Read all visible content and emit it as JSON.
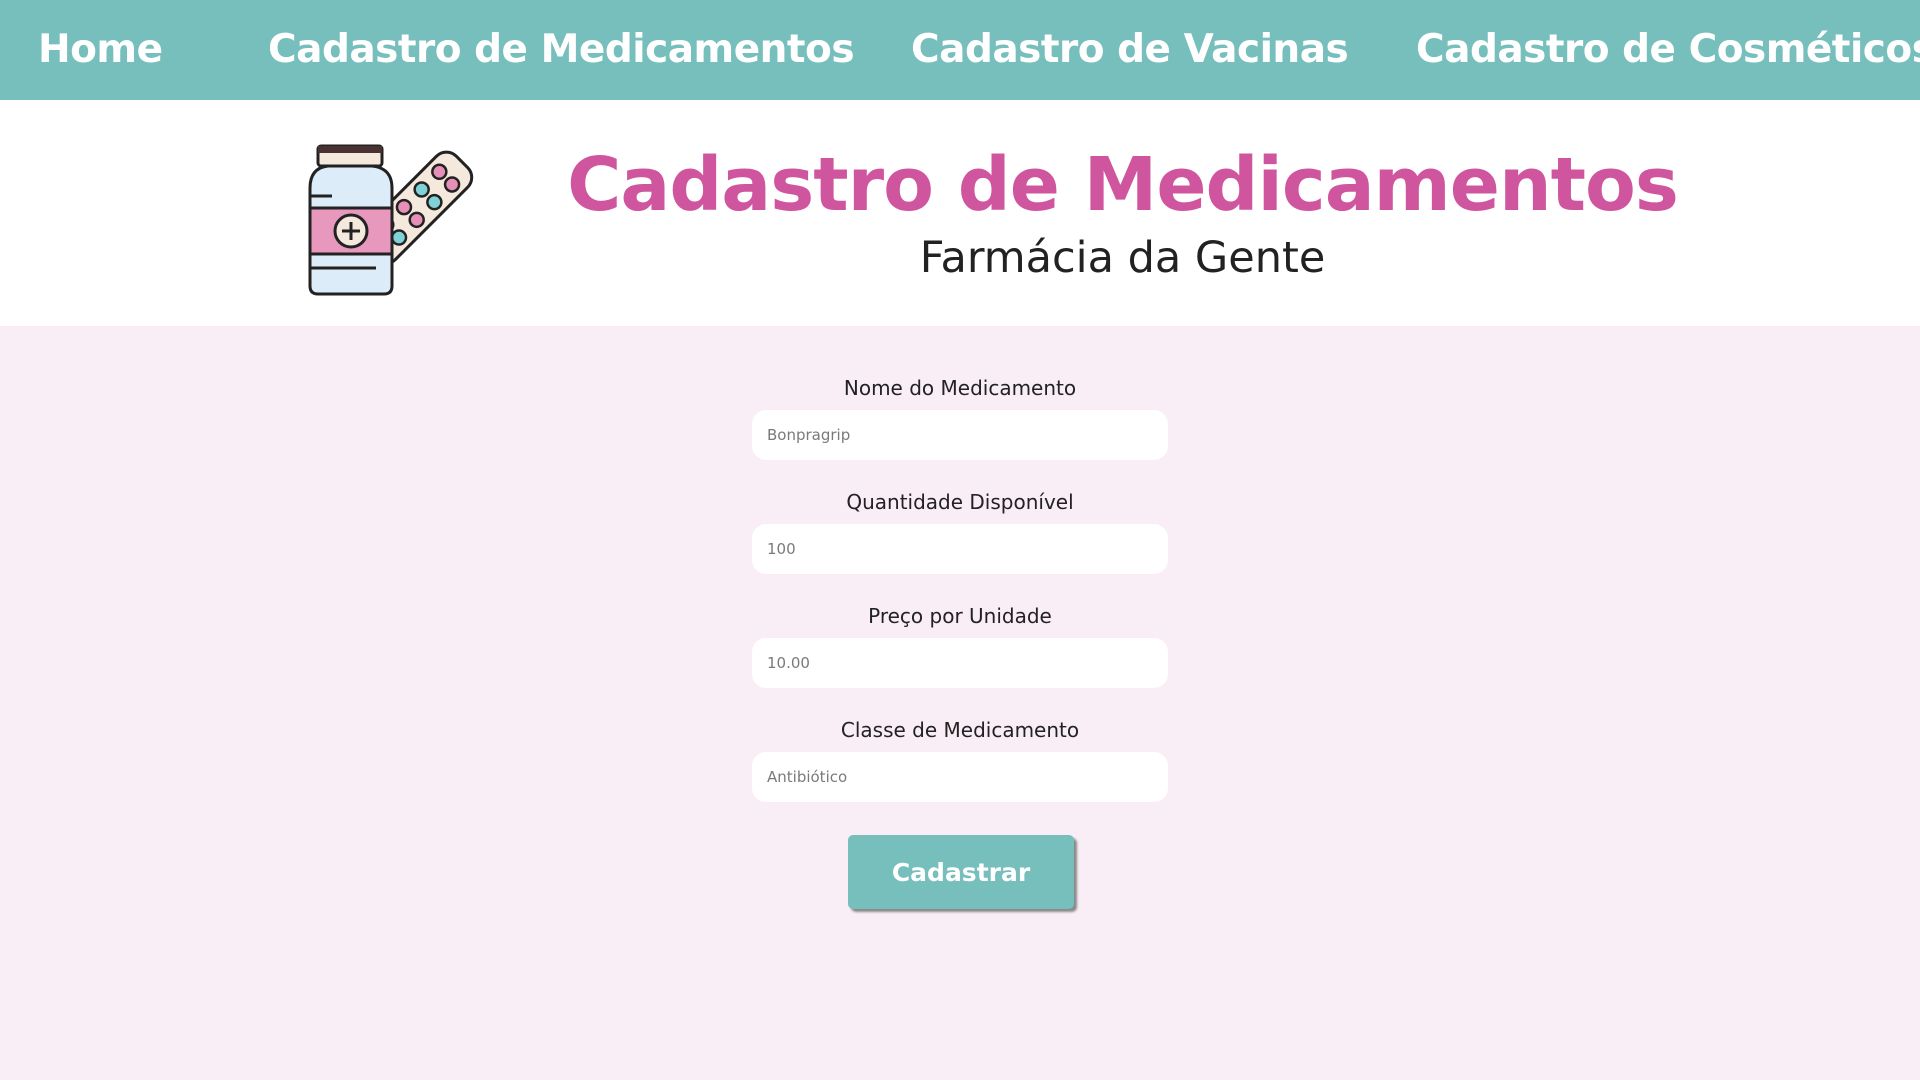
{
  "nav": {
    "items": [
      {
        "label": "Home"
      },
      {
        "label": "Cadastro de Medicamentos"
      },
      {
        "label": "Cadastro de Vacinas"
      },
      {
        "label": "Cadastro de Cosméticos"
      }
    ],
    "background_color": "#77bfbd",
    "text_color": "#ffffff"
  },
  "header": {
    "logo_icon": "medicine-bottle-and-pills-icon",
    "title": "Cadastro de Medicamentos",
    "subtitle": "Farmácia da Gente",
    "title_color": "#d0559f"
  },
  "form": {
    "fields": [
      {
        "label": "Nome do Medicamento",
        "placeholder": "Bonpragrip",
        "value": ""
      },
      {
        "label": "Quantidade Disponível",
        "placeholder": "100",
        "value": ""
      },
      {
        "label": "Preço por Unidade",
        "placeholder": "10.00",
        "value": ""
      },
      {
        "label": "Classe de Medicamento",
        "placeholder": "Antibiótico",
        "value": ""
      }
    ],
    "submit_label": "Cadastrar",
    "background_color": "#f9edf6"
  }
}
